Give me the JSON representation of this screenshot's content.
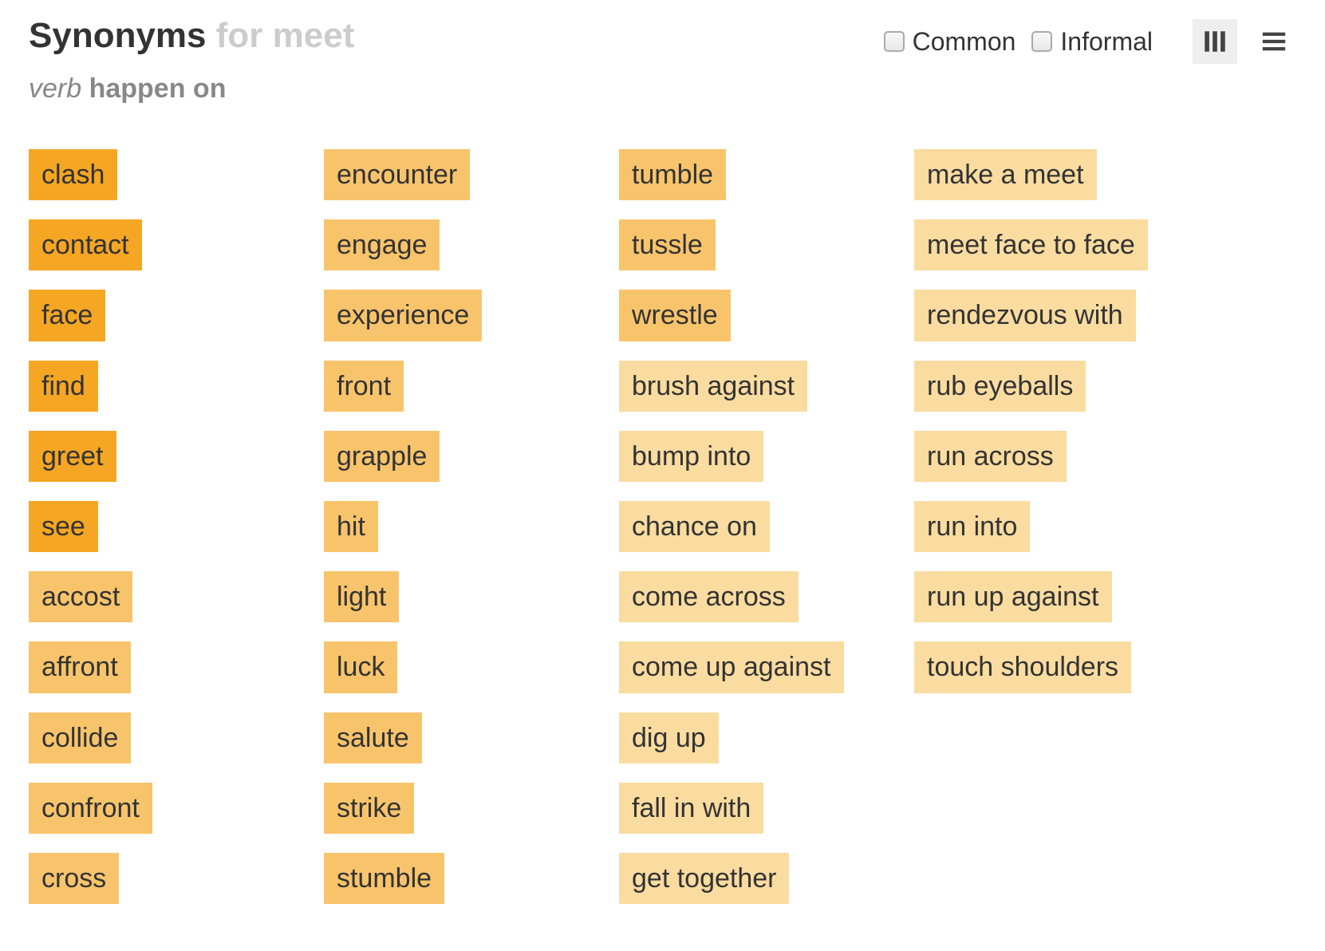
{
  "header": {
    "title_strong": "Synonyms",
    "title_faded": "for meet",
    "part_of_speech": "verb",
    "sense": "happen on"
  },
  "filters": {
    "common": "Common",
    "informal": "Informal"
  },
  "columns": [
    [
      {
        "word": "clash",
        "rank": 1
      },
      {
        "word": "contact",
        "rank": 1
      },
      {
        "word": "face",
        "rank": 1
      },
      {
        "word": "find",
        "rank": 1
      },
      {
        "word": "greet",
        "rank": 1
      },
      {
        "word": "see",
        "rank": 1
      },
      {
        "word": "accost",
        "rank": 2
      },
      {
        "word": "affront",
        "rank": 2
      },
      {
        "word": "collide",
        "rank": 2
      },
      {
        "word": "confront",
        "rank": 2
      },
      {
        "word": "cross",
        "rank": 2
      }
    ],
    [
      {
        "word": "encounter",
        "rank": 2
      },
      {
        "word": "engage",
        "rank": 2
      },
      {
        "word": "experience",
        "rank": 2
      },
      {
        "word": "front",
        "rank": 2
      },
      {
        "word": "grapple",
        "rank": 2
      },
      {
        "word": "hit",
        "rank": 2
      },
      {
        "word": "light",
        "rank": 2
      },
      {
        "word": "luck",
        "rank": 2
      },
      {
        "word": "salute",
        "rank": 2
      },
      {
        "word": "strike",
        "rank": 2
      },
      {
        "word": "stumble",
        "rank": 2
      }
    ],
    [
      {
        "word": "tumble",
        "rank": 2
      },
      {
        "word": "tussle",
        "rank": 2
      },
      {
        "word": "wrestle",
        "rank": 2
      },
      {
        "word": "brush against",
        "rank": 3
      },
      {
        "word": "bump into",
        "rank": 3
      },
      {
        "word": "chance on",
        "rank": 3
      },
      {
        "word": "come across",
        "rank": 3
      },
      {
        "word": "come up against",
        "rank": 3
      },
      {
        "word": "dig up",
        "rank": 3
      },
      {
        "word": "fall in with",
        "rank": 3
      },
      {
        "word": "get together",
        "rank": 3
      }
    ],
    [
      {
        "word": "make a meet",
        "rank": 3
      },
      {
        "word": "meet face to face",
        "rank": 3
      },
      {
        "word": "rendezvous with",
        "rank": 3
      },
      {
        "word": "rub eyeballs",
        "rank": 3
      },
      {
        "word": "run across",
        "rank": 3
      },
      {
        "word": "run into",
        "rank": 3
      },
      {
        "word": "run up against",
        "rank": 3
      },
      {
        "word": "touch shoulders",
        "rank": 3
      }
    ]
  ]
}
